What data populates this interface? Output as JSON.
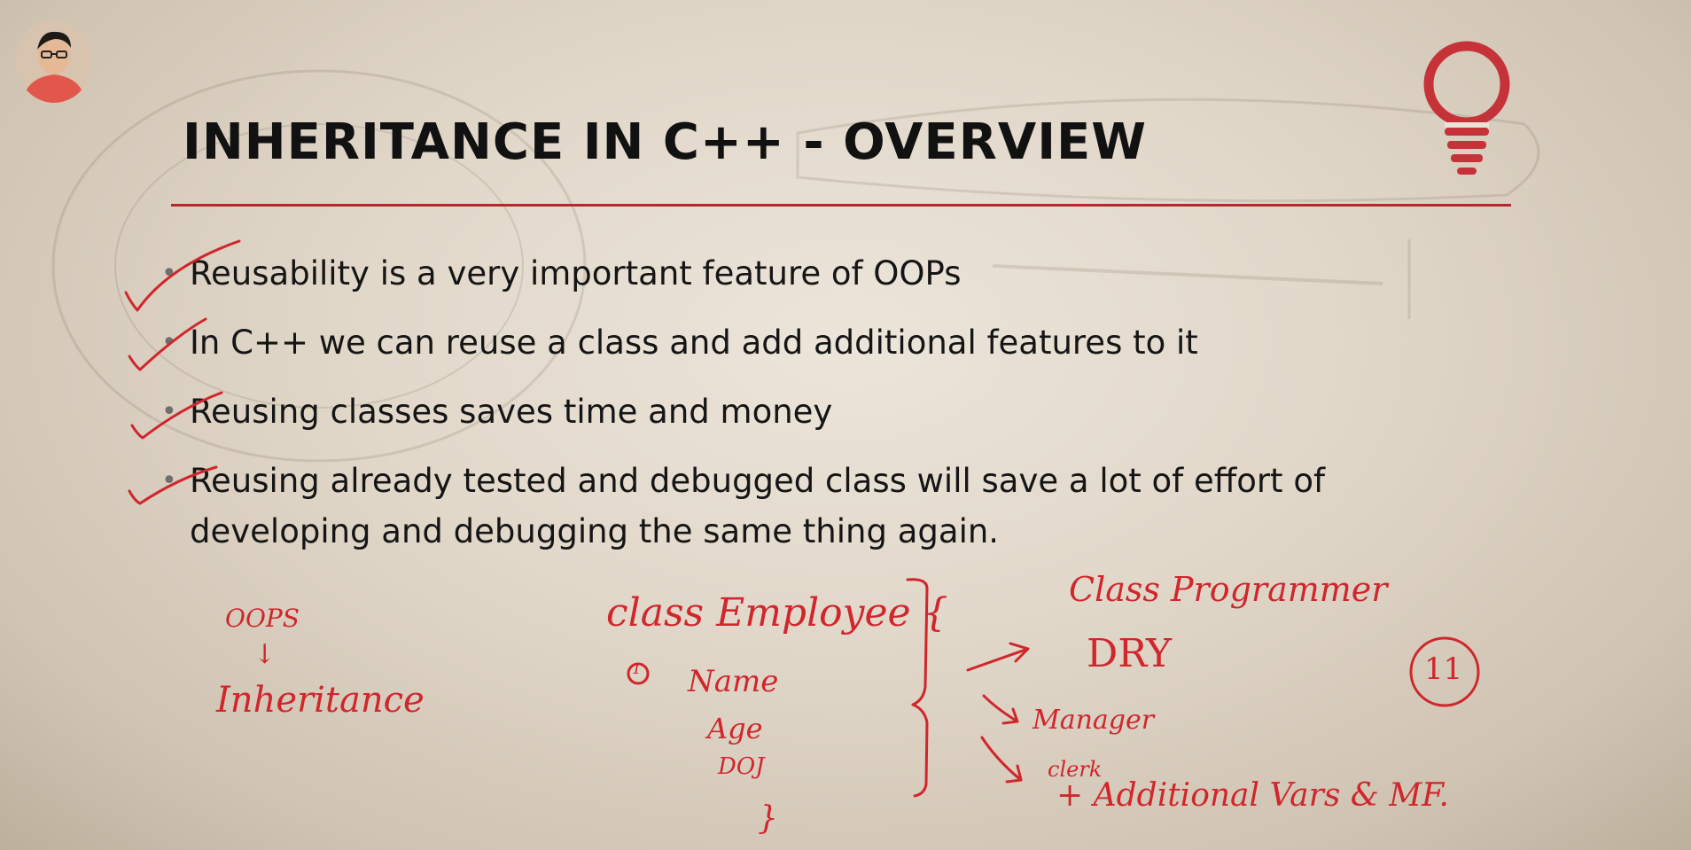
{
  "slide": {
    "title": "INHERITANCE IN C++ - OVERVIEW",
    "bullets": [
      "Reusability is a very important feature of OOPs",
      "In C++ we can reuse a class and add additional features to it",
      "Reusing classes saves time and money",
      "Reusing already tested and debugged class will save a lot of effort of developing and debugging the same thing again."
    ],
    "bullet_marker": "•"
  },
  "annotations": {
    "oops": "OOPS",
    "arrow_down": "↓",
    "inheritance": "Inheritance",
    "class_employee": "class Employee {",
    "circled_one": "1",
    "fields": [
      "Name",
      "Age",
      "DOJ"
    ],
    "closing_brace": "}",
    "class_programmer": "Class Programmer",
    "dry": "DRY",
    "manager": "Manager",
    "clerk": "clerk",
    "additional": "+ Additional Vars & MF.",
    "circled_eleven": "11"
  },
  "colors": {
    "accent": "#b8262e",
    "ink": "#d0262c",
    "text": "#151515"
  },
  "icons": {
    "header": "lightbulb-icon",
    "presenter": "avatar"
  }
}
